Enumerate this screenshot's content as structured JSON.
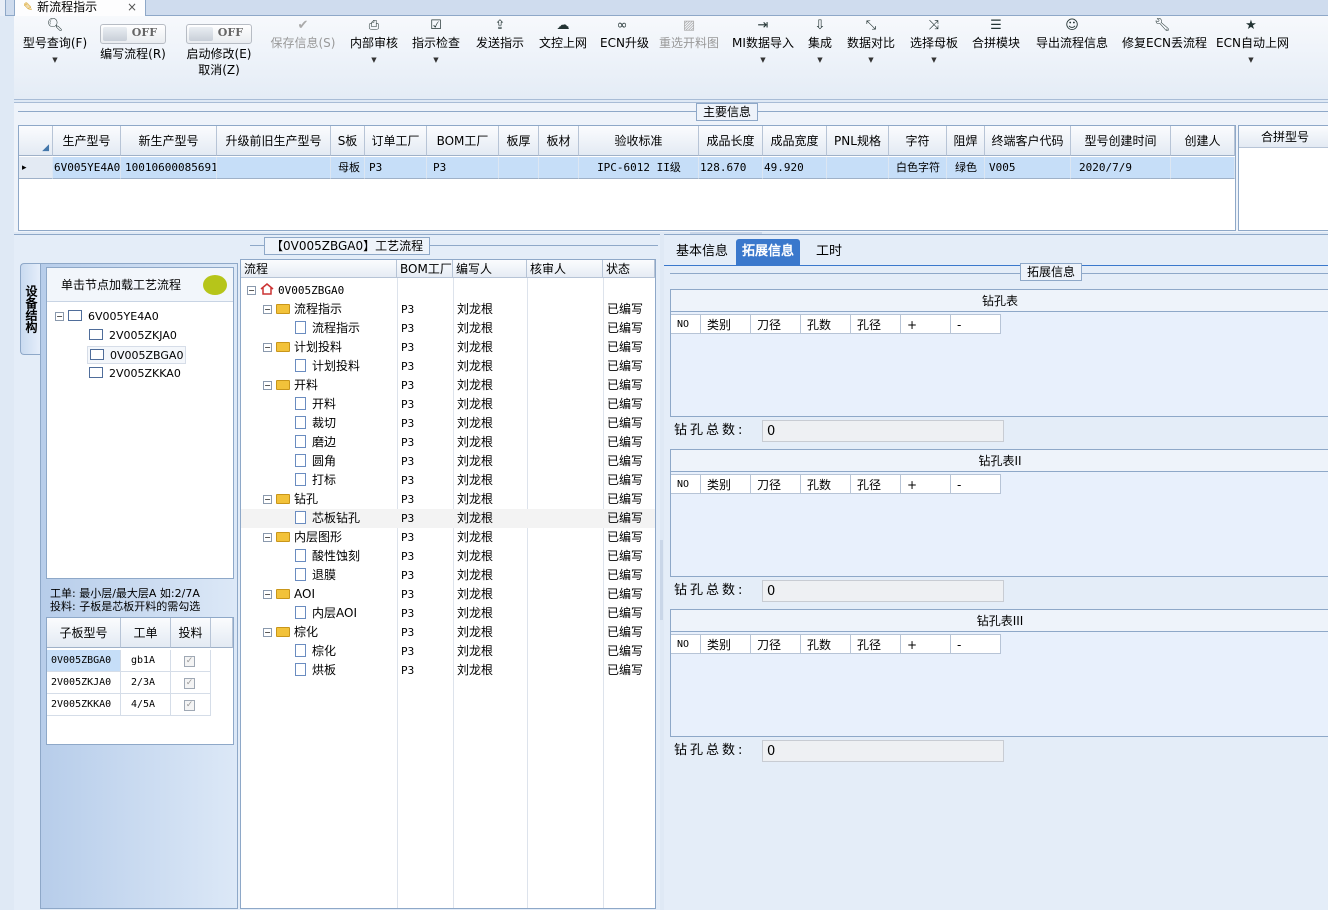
{
  "tab": {
    "title": "新流程指示",
    "close": "×"
  },
  "toolbar": {
    "query": {
      "icon": "search-icon",
      "label": "型号查询(F)"
    },
    "write_flow": {
      "state": "OFF",
      "label": "编写流程(R)"
    },
    "enable_modify": {
      "state": "OFF",
      "label": "启动修改(E)",
      "label2": "取消(Z)"
    },
    "save": {
      "icon": "check-icon",
      "label": "保存信息(S)"
    },
    "internal_review": {
      "icon": "printer-icon",
      "label": "内部审核"
    },
    "check": {
      "icon": "checkbox-icon",
      "label": "指示检查"
    },
    "send": {
      "icon": "upload-icon",
      "label": "发送指示"
    },
    "doc_online": {
      "icon": "cloud-upload-icon",
      "label": "文控上网"
    },
    "ecn_upgrade": {
      "icon": "binoculars-icon",
      "label": "ECN升级"
    },
    "reselect": {
      "icon": "image-icon",
      "label": "重选开料图"
    },
    "mi_import": {
      "icon": "import-icon",
      "label": "MI数据导入"
    },
    "integrate": {
      "icon": "download-icon",
      "label": "集成"
    },
    "compare": {
      "icon": "compress-icon",
      "label": "数据对比"
    },
    "mother": {
      "icon": "shuffle-icon",
      "label": "选择母板"
    },
    "merge_module": {
      "icon": "list-icon",
      "label": "合拼模块"
    },
    "export": {
      "icon": "smile-icon",
      "label": "导出流程信息"
    },
    "repair": {
      "icon": "wrench-icon",
      "label": "修复ECN丢流程"
    },
    "ecn_auto": {
      "icon": "star-icon",
      "label": "ECN自动上网"
    }
  },
  "main_info": {
    "title": "主要信息",
    "columns": [
      "生产型号",
      "新生产型号",
      "升级前旧生产型号",
      "S板",
      "订单工厂",
      "BOM工厂",
      "板厚",
      "板材",
      "验收标准",
      "成品长度",
      "成品宽度",
      "PNL规格",
      "字符",
      "阻焊",
      "终端客户代码",
      "型号创建时间",
      "创建人"
    ],
    "row": [
      "6V005YE4A0",
      "10010600085691",
      "",
      "母板",
      "P3",
      "P3",
      "",
      "",
      "IPC-6012 II级",
      "128.670",
      "49.920",
      "",
      "白色字符",
      "绿色",
      "V005",
      "2020/7/9",
      ""
    ],
    "row_marker": "▸",
    "merge_header": "合拼型号"
  },
  "structure": {
    "vertical_tab": "设备结构",
    "header": "单击节点加载工艺流程",
    "nodes": [
      "6V005YE4A0",
      "2V005ZKJA0",
      "0V005ZBGA0",
      "2V005ZKKA0"
    ],
    "note1": "工单: 最小层/最大层A 如:2/7A",
    "note2": "投料: 子板是芯板开料的需勾选",
    "sub_columns": [
      "子板型号",
      "工单",
      "投料"
    ],
    "sub_rows": [
      [
        "0V005ZBGA0",
        "gb1A",
        "✓"
      ],
      [
        "2V005ZKJA0",
        "2/3A",
        "✓"
      ],
      [
        "2V005ZKKA0",
        "4/5A",
        "✓"
      ]
    ]
  },
  "process": {
    "title": "【0V005ZBGA0】工艺流程",
    "columns": [
      "流程",
      "BOM工厂",
      "编写人",
      "核审人",
      "状态"
    ],
    "root": "0V005ZBGA0",
    "rows": [
      {
        "name": "流程指示",
        "type": "folder",
        "bom": "P3",
        "writer": "刘龙根",
        "status": "已编写"
      },
      {
        "name": "流程指示",
        "type": "leaf",
        "bom": "P3",
        "writer": "刘龙根",
        "status": "已编写"
      },
      {
        "name": "计划投料",
        "type": "folder",
        "bom": "P3",
        "writer": "刘龙根",
        "status": "已编写"
      },
      {
        "name": "计划投料",
        "type": "leaf",
        "bom": "P3",
        "writer": "刘龙根",
        "status": "已编写"
      },
      {
        "name": "开料",
        "type": "folder",
        "bom": "P3",
        "writer": "刘龙根",
        "status": "已编写"
      },
      {
        "name": "开料",
        "type": "leaf",
        "bom": "P3",
        "writer": "刘龙根",
        "status": "已编写"
      },
      {
        "name": "裁切",
        "type": "leaf",
        "bom": "P3",
        "writer": "刘龙根",
        "status": "已编写"
      },
      {
        "name": "磨边",
        "type": "leaf",
        "bom": "P3",
        "writer": "刘龙根",
        "status": "已编写"
      },
      {
        "name": "圆角",
        "type": "leaf",
        "bom": "P3",
        "writer": "刘龙根",
        "status": "已编写"
      },
      {
        "name": "打标",
        "type": "leaf",
        "bom": "P3",
        "writer": "刘龙根",
        "status": "已编写"
      },
      {
        "name": "钻孔",
        "type": "folder",
        "bom": "P3",
        "writer": "刘龙根",
        "status": "已编写"
      },
      {
        "name": "芯板钻孔",
        "type": "leaf",
        "bom": "P3",
        "writer": "刘龙根",
        "status": "已编写"
      },
      {
        "name": "内层图形",
        "type": "folder",
        "bom": "P3",
        "writer": "刘龙根",
        "status": "已编写"
      },
      {
        "name": "酸性蚀刻",
        "type": "leaf",
        "bom": "P3",
        "writer": "刘龙根",
        "status": "已编写"
      },
      {
        "name": "退膜",
        "type": "leaf",
        "bom": "P3",
        "writer": "刘龙根",
        "status": "已编写"
      },
      {
        "name": "AOI",
        "type": "folder",
        "bom": "P3",
        "writer": "刘龙根",
        "status": "已编写"
      },
      {
        "name": "内层AOI",
        "type": "leaf",
        "bom": "P3",
        "writer": "刘龙根",
        "status": "已编写"
      },
      {
        "name": "棕化",
        "type": "folder",
        "bom": "P3",
        "writer": "刘龙根",
        "status": "已编写"
      },
      {
        "name": "棕化",
        "type": "leaf",
        "bom": "P3",
        "writer": "刘龙根",
        "status": "已编写"
      },
      {
        "name": "烘板",
        "type": "leaf",
        "bom": "P3",
        "writer": "刘龙根",
        "status": "已编写"
      }
    ]
  },
  "right": {
    "tabs": [
      "基本信息",
      "拓展信息",
      "工时"
    ],
    "group_title": "拓展信息",
    "drill_columns": [
      "NO",
      "类别",
      "刀径",
      "孔数",
      "孔径",
      "+",
      "-"
    ],
    "tables": [
      {
        "title": "钻孔表",
        "total_label": "钻孔总数:",
        "total": "0"
      },
      {
        "title": "钻孔表II",
        "total_label": "钻孔总数:",
        "total": "0"
      },
      {
        "title": "钻孔表III",
        "total_label": "钻孔总数:",
        "total": "0"
      }
    ]
  }
}
